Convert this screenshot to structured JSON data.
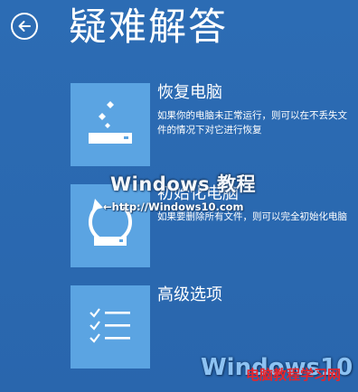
{
  "header": {
    "title": "疑难解答"
  },
  "options": [
    {
      "title": "恢复电脑",
      "description": "如果你的电脑未正常运行，则可以在不丢失文件的情况下对它进行恢复",
      "icon": "refresh-pc-icon"
    },
    {
      "title": "初始化电脑",
      "description": "如果要删除所有文件，则可以完全初始化电脑",
      "icon": "reset-pc-icon"
    },
    {
      "title": "高级选项",
      "description": "",
      "icon": "checklist-icon"
    }
  ],
  "watermarks": {
    "center": "Windows 教程",
    "url": "←http://Windows10.com",
    "bottom_left": "Windows10",
    "bottom_site": "电脑教程学习网"
  },
  "colors": {
    "background": "#2a6ab2",
    "tile": "#5ba4e2",
    "text": "#ffffff",
    "site_watermark": "#e8242a"
  }
}
